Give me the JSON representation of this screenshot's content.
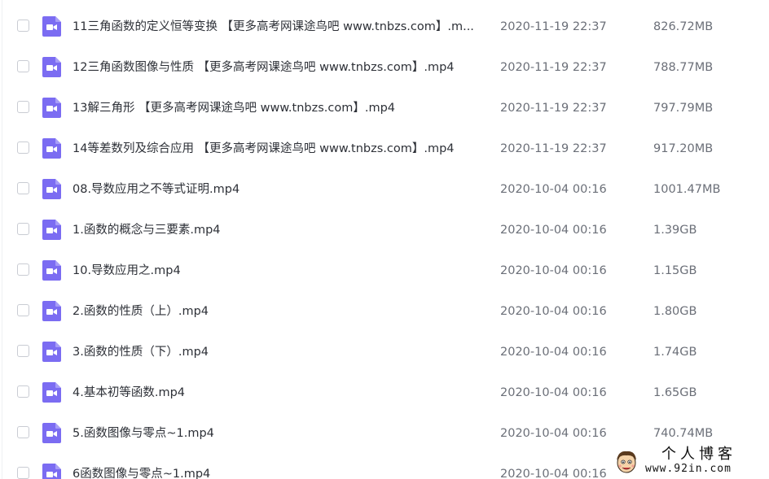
{
  "files": [
    {
      "name": "11三角函数的定义恒等变换 【更多高考网课途鸟吧 www.tnbzs.com】.m...",
      "date": "2020-11-19 22:37",
      "size": "826.72MB"
    },
    {
      "name": "12三角函数图像与性质 【更多高考网课途鸟吧 www.tnbzs.com】.mp4",
      "date": "2020-11-19 22:37",
      "size": "788.77MB"
    },
    {
      "name": "13解三角形 【更多高考网课途鸟吧 www.tnbzs.com】.mp4",
      "date": "2020-11-19 22:37",
      "size": "797.79MB"
    },
    {
      "name": "14等差数列及综合应用 【更多高考网课途鸟吧 www.tnbzs.com】.mp4",
      "date": "2020-11-19 22:37",
      "size": "917.20MB"
    },
    {
      "name": "08.导数应用之不等式证明.mp4",
      "date": "2020-10-04 00:16",
      "size": "1001.47MB"
    },
    {
      "name": "1.函数的概念与三要素.mp4",
      "date": "2020-10-04 00:16",
      "size": "1.39GB"
    },
    {
      "name": "10.导数应用之.mp4",
      "date": "2020-10-04 00:16",
      "size": "1.15GB"
    },
    {
      "name": "2.函数的性质（上）.mp4",
      "date": "2020-10-04 00:16",
      "size": "1.80GB"
    },
    {
      "name": "3.函数的性质（下）.mp4",
      "date": "2020-10-04 00:16",
      "size": "1.74GB"
    },
    {
      "name": "4.基本初等函数.mp4",
      "date": "2020-10-04 00:16",
      "size": "1.65GB"
    },
    {
      "name": "5.函数图像与零点~1.mp4",
      "date": "2020-10-04 00:16",
      "size": "740.74MB"
    },
    {
      "name": "6函数图像与零点~1.mp4",
      "date": "2020-10-04 00:16",
      "size": ""
    }
  ],
  "watermark": {
    "title": "个人博客",
    "url": "www.92in.com"
  },
  "colors": {
    "video_icon": "#7b6cf2",
    "video_icon_fold": "#a79df7"
  },
  "icons": {
    "file_type": "video-file-icon",
    "watermark": "cartoon-face-icon"
  }
}
